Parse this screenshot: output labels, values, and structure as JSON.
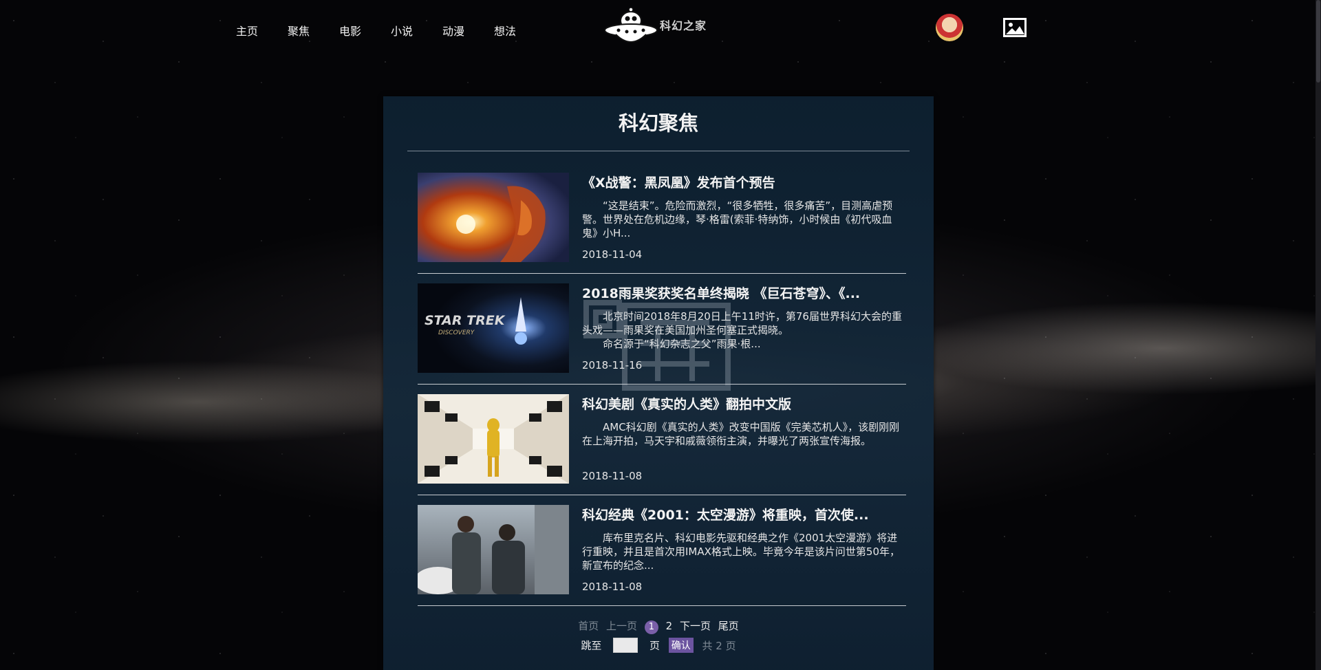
{
  "nav": {
    "items": [
      {
        "label": "主页"
      },
      {
        "label": "聚焦"
      },
      {
        "label": "电影"
      },
      {
        "label": "小说"
      },
      {
        "label": "动漫"
      },
      {
        "label": "想法"
      }
    ]
  },
  "logo": {
    "text": "科幻之家",
    "icon": "ufo-icon"
  },
  "header_icons": {
    "avatar": "user-avatar",
    "image": "image-icon"
  },
  "main": {
    "title": "科幻聚焦",
    "articles": [
      {
        "title": "《X战警：黑凤凰》发布首个预告",
        "summary": "“这是结束”。危险而激烈，“很多牺牲，很多痛苦”，目测高虐预警。世界处在危机边缘，琴·格雷(索菲·特纳饰，小时候由《初代吸血鬼》小H...",
        "date": "2018-11-04",
        "thumb": "phoenix-fire-image"
      },
      {
        "title": "2018雨果奖获奖名单终揭晓 《巨石苍穹》、《...",
        "summary": "北京时间2018年8月20日上午11时许，第76届世界科幻大会的重头戏——雨果奖在美国加州圣何塞正式揭晓。\n　　命名源于“科幻杂志之父”雨果·根...",
        "date": "2018-11-16",
        "thumb": "star-trek-discovery-image",
        "thumb_text_1": "STAR TREK",
        "thumb_text_2": "DISCOVERY"
      },
      {
        "title": "科幻美剧《真实的人类》翻拍中文版",
        "summary": "AMC科幻剧《真实的人类》改变中国版《完美芯机人》，该剧刚刚在上海开拍，马天宇和戚薇领衔主演，并曝光了两张宣传海报。",
        "date": "2018-11-08",
        "thumb": "astronaut-corridor-image"
      },
      {
        "title": "科幻经典《2001：太空漫游》将重映，首次使...",
        "summary": "库布里克名片、科幻电影先驱和经典之作《2001太空漫游》将进行重映，并且是首次用IMAX格式上映。毕竟今年是该片问世第50年，新宣布的纪念...",
        "date": "2018-11-08",
        "thumb": "two-men-street-image"
      }
    ]
  },
  "pagination": {
    "first": "首页",
    "prev": "上一页",
    "current": "1",
    "page2": "2",
    "next": "下一页",
    "last": "尾页",
    "jump_label": "跳至",
    "jump_value": "",
    "page_unit": "页",
    "confirm": "确认",
    "total": "共 2 页"
  },
  "colors": {
    "panel_bg": "#0d2030",
    "accent": "#6c54a0",
    "text": "#f2f2f2",
    "muted": "#7f8a95"
  }
}
